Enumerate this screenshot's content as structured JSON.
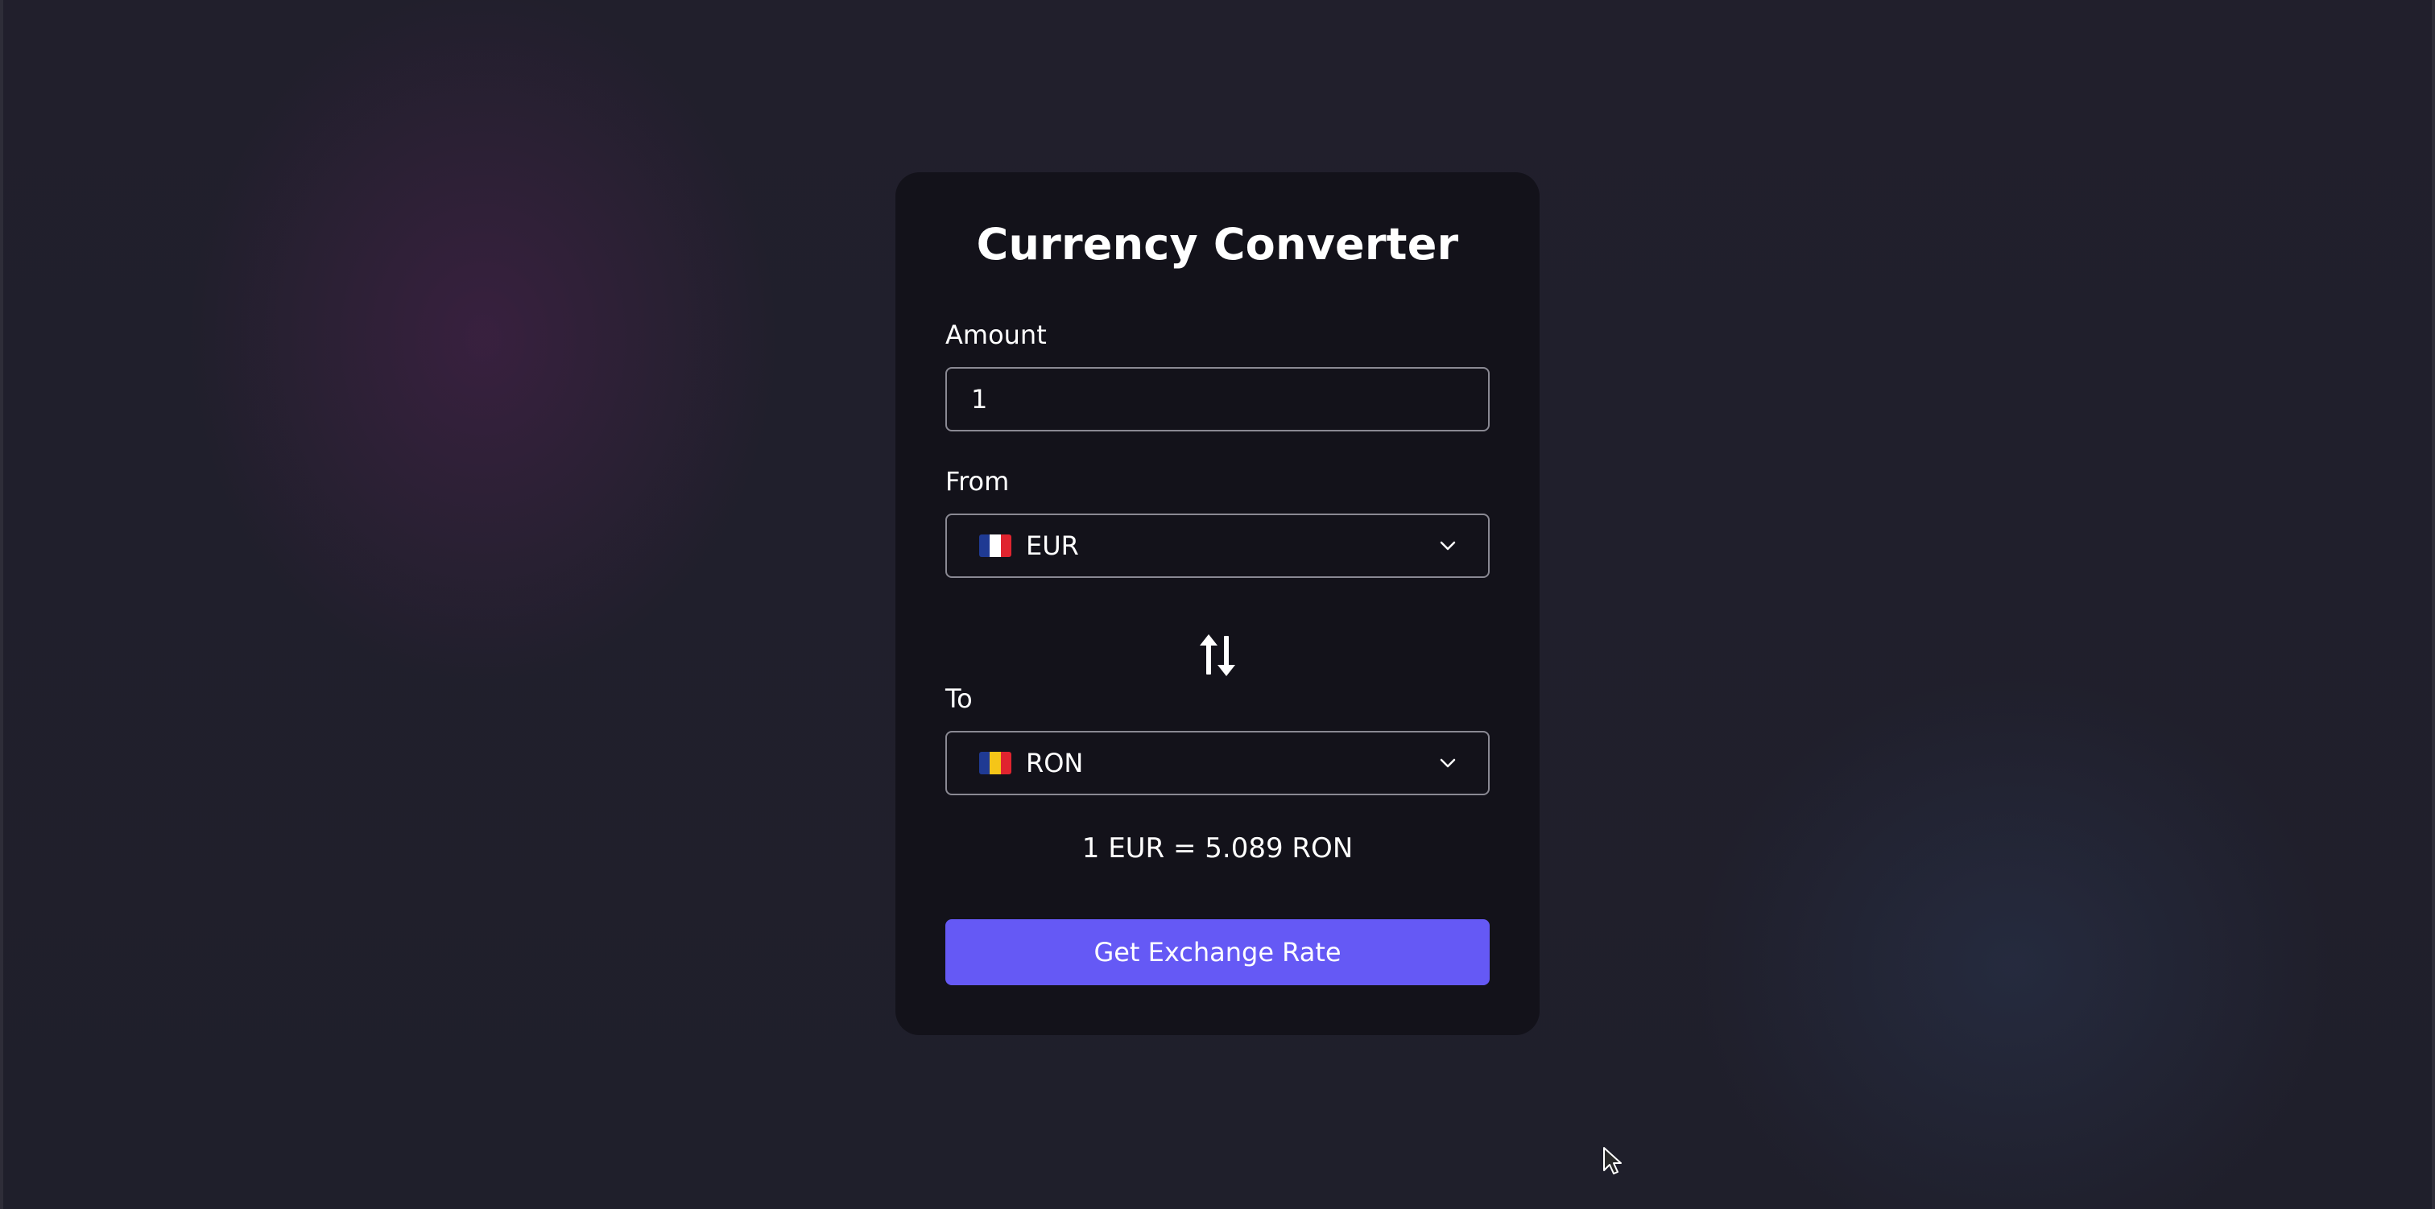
{
  "app": {
    "title": "Currency Converter"
  },
  "amount": {
    "label": "Amount",
    "value": "1"
  },
  "from": {
    "label": "From",
    "currency": "EUR",
    "flag_icon": "france-flag-icon"
  },
  "swap": {
    "icon": "swap-arrows-icon"
  },
  "to": {
    "label": "To",
    "currency": "RON",
    "flag_icon": "romania-flag-icon"
  },
  "result": {
    "text": "1 EUR = 5.089 RON"
  },
  "actions": {
    "get_rate_label": "Get Exchange Rate"
  },
  "colors": {
    "background": "#1f1e2a",
    "card": "#13121a",
    "accent": "#6559f5",
    "text": "#ffffff",
    "border": "#8a8993"
  }
}
